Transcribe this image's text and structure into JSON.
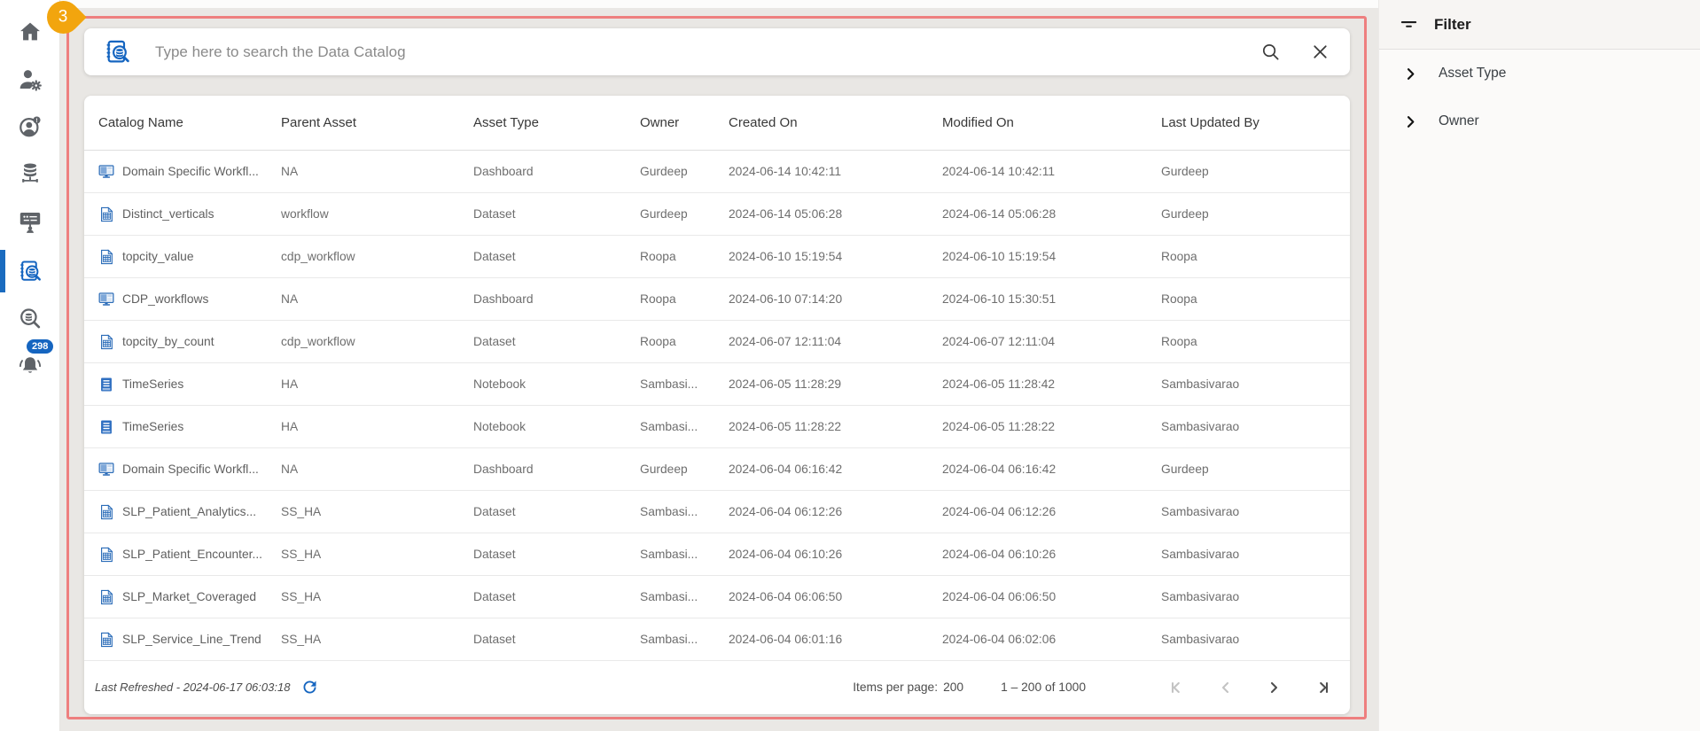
{
  "overlay_badge": "3",
  "sidebar": {
    "items": [
      {
        "icon": "home",
        "active": false
      },
      {
        "icon": "user-settings",
        "active": false
      },
      {
        "icon": "user-status",
        "active": false
      },
      {
        "icon": "data-sources",
        "active": false
      },
      {
        "icon": "training",
        "active": false
      },
      {
        "icon": "data-catalog",
        "active": true
      },
      {
        "icon": "data-search",
        "active": false
      },
      {
        "icon": "notifications",
        "active": false,
        "badge": "298"
      }
    ]
  },
  "search": {
    "placeholder": "Type here to search the Data Catalog"
  },
  "table": {
    "columns": [
      "Catalog Name",
      "Parent Asset",
      "Asset Type",
      "Owner",
      "Created On",
      "Modified On",
      "Last Updated By"
    ],
    "rows": [
      {
        "icon": "dashboard",
        "name": "Domain Specific Workfl...",
        "parent": "NA",
        "type": "Dashboard",
        "owner": "Gurdeep",
        "created": "2024-06-14 10:42:11",
        "modified": "2024-06-14 10:42:11",
        "updated_by": "Gurdeep"
      },
      {
        "icon": "dataset",
        "name": "Distinct_verticals",
        "parent": "workflow",
        "type": "Dataset",
        "owner": "Gurdeep",
        "created": "2024-06-14 05:06:28",
        "modified": "2024-06-14 05:06:28",
        "updated_by": "Gurdeep"
      },
      {
        "icon": "dataset",
        "name": "topcity_value",
        "parent": "cdp_workflow",
        "type": "Dataset",
        "owner": "Roopa",
        "created": "2024-06-10 15:19:54",
        "modified": "2024-06-10 15:19:54",
        "updated_by": "Roopa"
      },
      {
        "icon": "dashboard",
        "name": "CDP_workflows",
        "parent": "NA",
        "type": "Dashboard",
        "owner": "Roopa",
        "created": "2024-06-10 07:14:20",
        "modified": "2024-06-10 15:30:51",
        "updated_by": "Roopa"
      },
      {
        "icon": "dataset",
        "name": "topcity_by_count",
        "parent": "cdp_workflow",
        "type": "Dataset",
        "owner": "Roopa",
        "created": "2024-06-07 12:11:04",
        "modified": "2024-06-07 12:11:04",
        "updated_by": "Roopa"
      },
      {
        "icon": "notebook",
        "name": "TimeSeries",
        "parent": "HA",
        "type": "Notebook",
        "owner": "Sambasi...",
        "created": "2024-06-05 11:28:29",
        "modified": "2024-06-05 11:28:42",
        "updated_by": "Sambasivarao"
      },
      {
        "icon": "notebook",
        "name": "TimeSeries",
        "parent": "HA",
        "type": "Notebook",
        "owner": "Sambasi...",
        "created": "2024-06-05 11:28:22",
        "modified": "2024-06-05 11:28:22",
        "updated_by": "Sambasivarao"
      },
      {
        "icon": "dashboard",
        "name": "Domain Specific Workfl...",
        "parent": "NA",
        "type": "Dashboard",
        "owner": "Gurdeep",
        "created": "2024-06-04 06:16:42",
        "modified": "2024-06-04 06:16:42",
        "updated_by": "Gurdeep"
      },
      {
        "icon": "dataset",
        "name": "SLP_Patient_Analytics...",
        "parent": "SS_HA",
        "type": "Dataset",
        "owner": "Sambasi...",
        "created": "2024-06-04 06:12:26",
        "modified": "2024-06-04 06:12:26",
        "updated_by": "Sambasivarao"
      },
      {
        "icon": "dataset",
        "name": "SLP_Patient_Encounter...",
        "parent": "SS_HA",
        "type": "Dataset",
        "owner": "Sambasi...",
        "created": "2024-06-04 06:10:26",
        "modified": "2024-06-04 06:10:26",
        "updated_by": "Sambasivarao"
      },
      {
        "icon": "dataset",
        "name": "SLP_Market_Coveraged",
        "parent": "SS_HA",
        "type": "Dataset",
        "owner": "Sambasi...",
        "created": "2024-06-04 06:06:50",
        "modified": "2024-06-04 06:06:50",
        "updated_by": "Sambasivarao"
      },
      {
        "icon": "dataset",
        "name": "SLP_Service_Line_Trend",
        "parent": "SS_HA",
        "type": "Dataset",
        "owner": "Sambasi...",
        "created": "2024-06-04 06:01:16",
        "modified": "2024-06-04 06:02:06",
        "updated_by": "Sambasivarao"
      }
    ]
  },
  "footer": {
    "last_refreshed": "Last Refreshed - 2024-06-17 06:03:18",
    "items_per_page_label": "Items per page:",
    "items_per_page": "200",
    "range": "1 – 200 of 1000"
  },
  "filter": {
    "title": "Filter",
    "sections": [
      {
        "label": "Asset Type"
      },
      {
        "label": "Owner"
      }
    ]
  },
  "colors": {
    "accent_blue": "#1565c0",
    "highlight_border": "#ee7f7f",
    "badge_orange": "#f2a50e"
  }
}
